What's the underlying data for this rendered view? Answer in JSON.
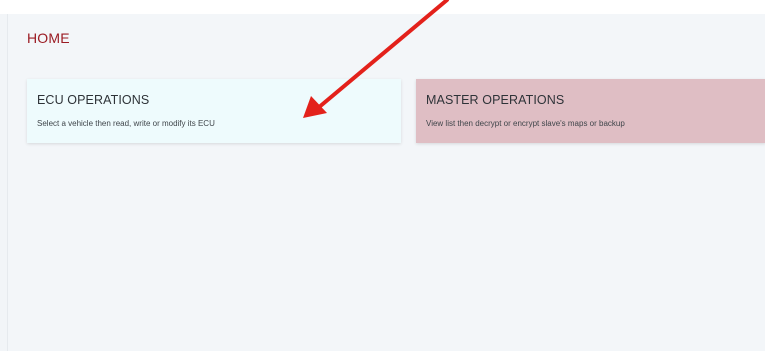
{
  "page": {
    "title": "HOME"
  },
  "cards": {
    "ecu": {
      "title": "ECU OPERATIONS",
      "description": "Select a vehicle then read, write or modify its ECU"
    },
    "master": {
      "title": "MASTER OPERATIONS",
      "description": "View list then decrypt or encrypt slave's maps or backup"
    }
  },
  "colors": {
    "title_red": "#9b1c24",
    "ecu_card_bg": "#eefbfd",
    "master_card_bg": "#dfbec4",
    "annotation_arrow": "#e3211b"
  }
}
